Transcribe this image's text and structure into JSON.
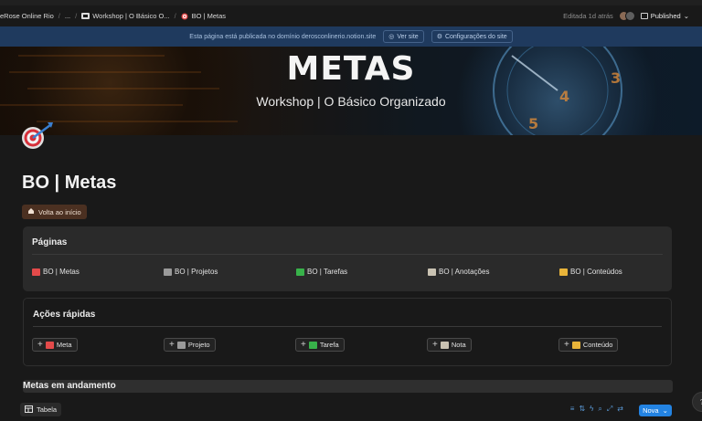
{
  "breadcrumb": {
    "workspace": "eRose Online Rio",
    "ellipsis": "...",
    "parent": "Workshop | O Básico O...",
    "current": "BO | Metas"
  },
  "topbar": {
    "edited": "Editada 1d atrás",
    "published_label": "Published"
  },
  "banner": {
    "text": "Esta página está publicada no domínio derosconlinerio.notion.site",
    "view_site": "Ver site",
    "site_settings": "Configurações do site"
  },
  "cover": {
    "title": "METAS",
    "subtitle": "Workshop | O Básico Organizado"
  },
  "page": {
    "title": "BO | Metas",
    "home_button": "Volta ao início"
  },
  "pages_card": {
    "title": "Páginas",
    "links": [
      {
        "label": "BO | Metas",
        "color": "#e34a4a"
      },
      {
        "label": "BO | Projetos",
        "color": "#9a9a9a"
      },
      {
        "label": "BO | Tarefas",
        "color": "#38b24a"
      },
      {
        "label": "BO | Anotações",
        "color": "#c9c2b2"
      },
      {
        "label": "BO | Conteúdos",
        "color": "#e8b43a"
      }
    ]
  },
  "actions_card": {
    "title": "Ações rápidas",
    "buttons": [
      {
        "label": "Meta",
        "color": "#e34a4a"
      },
      {
        "label": "Projeto",
        "color": "#9a9a9a"
      },
      {
        "label": "Tarefa",
        "color": "#38b24a"
      },
      {
        "label": "Nota",
        "color": "#c9c2b2"
      },
      {
        "label": "Conteúdo",
        "color": "#e8b43a"
      }
    ]
  },
  "section": {
    "title": "Metas em andamento"
  },
  "database": {
    "view_tab": "Tabela",
    "new_button": "Nova"
  }
}
